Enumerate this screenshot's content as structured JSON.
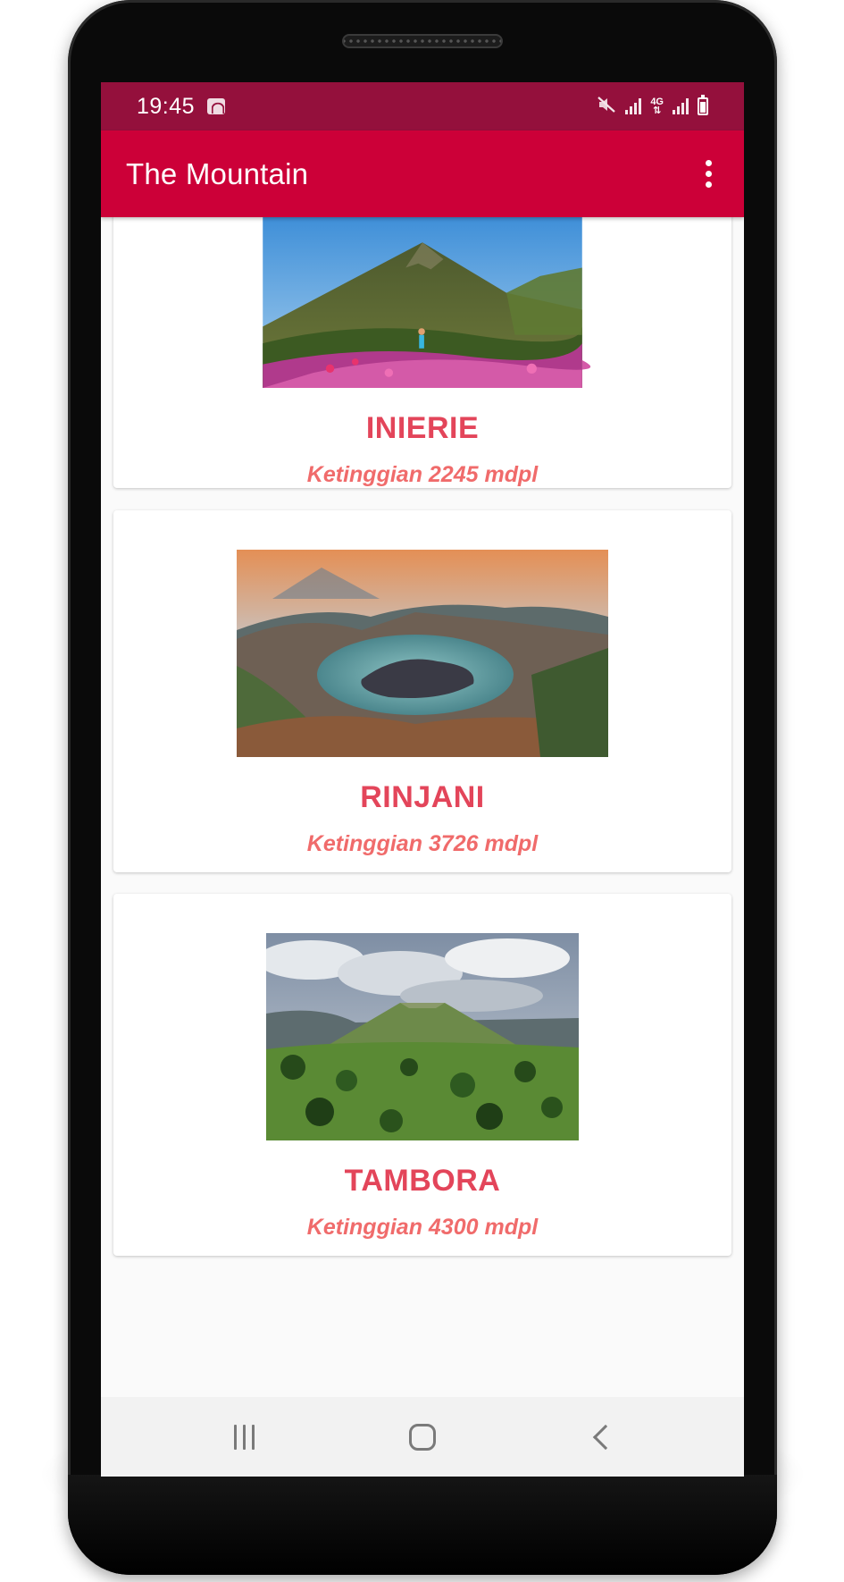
{
  "status_bar": {
    "time": "19:45",
    "icons": [
      "wifi-hotspot-icon",
      "mute-icon",
      "signal-icon",
      "4g-icon",
      "signal-icon",
      "battery-charging-icon"
    ],
    "network_label": "4G"
  },
  "app_bar": {
    "title": "The Mountain",
    "menu_icon": "more-vert-icon"
  },
  "mountains": [
    {
      "name": "INIERIE",
      "height_label": "Ketinggian 2245 mdpl",
      "image": "mountain-peak-with-flowers"
    },
    {
      "name": "RINJANI",
      "height_label": "Ketinggian 3726 mdpl",
      "image": "crater-lake"
    },
    {
      "name": "TAMBORA",
      "height_label": "Ketinggian 4300 mdpl",
      "image": "mountain-under-clouds"
    }
  ],
  "nav_bar": {
    "buttons": [
      "recent-apps-icon",
      "home-icon",
      "back-icon"
    ]
  },
  "colors": {
    "status_bar": "#94103c",
    "app_bar": "#cc0038",
    "mountain_name": "#e3455a",
    "mountain_height": "#f06b6b"
  }
}
